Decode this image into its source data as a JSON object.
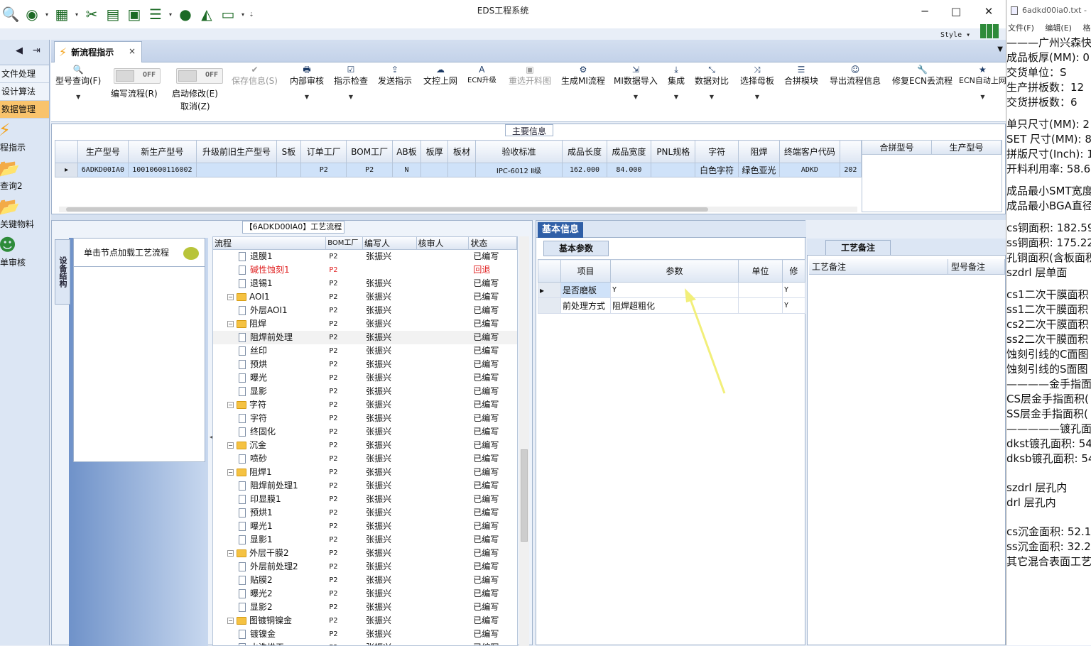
{
  "app": {
    "title": "EDS工程系统",
    "style_label": "Style"
  },
  "window_controls": {
    "minimize": "─",
    "maximize": "□",
    "close": "✕"
  },
  "quick_toolbar": [
    "search-icon",
    "globe-icon",
    "table-icon",
    "scissors-icon",
    "film-icon",
    "clipboard-icon",
    "list-icon",
    "user-icon",
    "chart-icon",
    "monitor-icon"
  ],
  "left_nav": {
    "items": [
      {
        "label": "文件处理"
      },
      {
        "label": "设计算法"
      },
      {
        "label": "数据管理"
      }
    ],
    "big": [
      {
        "label": "程指示",
        "icon": "bolt-icon"
      },
      {
        "label": "查询2",
        "icon": "folder-icon"
      },
      {
        "label": "关键物料",
        "icon": "folder-icon"
      },
      {
        "label": "单审核",
        "icon": "user-icon"
      }
    ]
  },
  "tab": {
    "label": "新流程指示",
    "close": "×"
  },
  "toolbar": {
    "model_query": "型号查询(F)",
    "toggle_off": "OFF",
    "write_flow": "编写流程(R)",
    "start_modify": "启动修改(E)",
    "cancel": "取消(Z)",
    "buttons": [
      {
        "label": "保存信息(S)",
        "icon": "✔"
      },
      {
        "label": "内部审核",
        "icon": "🖶"
      },
      {
        "label": "指示检查",
        "icon": "☑"
      },
      {
        "label": "发送指示",
        "icon": "⇪"
      },
      {
        "label": "文控上网",
        "icon": "☁"
      },
      {
        "label": "ECN升级",
        "icon": "A"
      },
      {
        "label": "重选开料图",
        "icon": "▣"
      },
      {
        "label": "生成MI流程",
        "icon": "⚙"
      },
      {
        "label": "MI数据导入",
        "icon": "⇲"
      },
      {
        "label": "集成",
        "icon": "⤓"
      },
      {
        "label": "数据对比",
        "icon": "⤡"
      },
      {
        "label": "选择母板",
        "icon": "⤨"
      },
      {
        "label": "合拼模块",
        "icon": "☰"
      },
      {
        "label": "导出流程信息",
        "icon": "☺"
      },
      {
        "label": "修复ECN丢流程",
        "icon": "🔧"
      },
      {
        "label": "ECN自动上网",
        "icon": "★"
      }
    ]
  },
  "main_info": {
    "title": "主要信息",
    "headers": [
      "生产型号",
      "新生产型号",
      "升级前旧生产型号",
      "S板",
      "订单工厂",
      "BOM工厂",
      "AB板",
      "板厚",
      "板材",
      "验收标准",
      "成品长度",
      "成品宽度",
      "PNL规格",
      "字符",
      "阻焊",
      "终端客户代码"
    ],
    "row": [
      "6ADKD00IA0",
      "10010600116002",
      "",
      "",
      "P2",
      "P2",
      "N",
      "",
      "",
      "IPC-6012 Ⅱ级",
      "162.000",
      "84.000",
      "",
      "白色字符",
      "绿色亚光",
      "ADKD",
      "202"
    ],
    "merge_headers": [
      "合拼型号",
      "生产型号"
    ]
  },
  "process": {
    "title": "【6ADKD00IA0】工艺流程",
    "vtab": "设备结构",
    "click_hint": "单击节点加载工艺流程",
    "headers": [
      "流程",
      "BOM工厂",
      "编写人",
      "核审人",
      "状态"
    ],
    "rows": [
      {
        "name": "退膜1",
        "lvl": 2,
        "factory": "P2",
        "writer": "张振兴",
        "status": "已编写"
      },
      {
        "name": "碱性蚀刻1",
        "lvl": 2,
        "factory": "P2",
        "writer": "",
        "status": "回退",
        "red": true
      },
      {
        "name": "退锡1",
        "lvl": 2,
        "factory": "P2",
        "writer": "张振兴",
        "status": "已编写"
      },
      {
        "name": "AOI1",
        "lvl": 1,
        "factory": "P2",
        "writer": "张振兴",
        "status": "已编写"
      },
      {
        "name": "外层AOI1",
        "lvl": 2,
        "factory": "P2",
        "writer": "张振兴",
        "status": "已编写"
      },
      {
        "name": "阻焊",
        "lvl": 1,
        "factory": "P2",
        "writer": "张振兴",
        "status": "已编写"
      },
      {
        "name": "阻焊前处理",
        "lvl": 2,
        "factory": "P2",
        "writer": "张振兴",
        "status": "已编写",
        "hl": true
      },
      {
        "name": "丝印",
        "lvl": 2,
        "factory": "P2",
        "writer": "张振兴",
        "status": "已编写"
      },
      {
        "name": "预烘",
        "lvl": 2,
        "factory": "P2",
        "writer": "张振兴",
        "status": "已编写"
      },
      {
        "name": "曝光",
        "lvl": 2,
        "factory": "P2",
        "writer": "张振兴",
        "status": "已编写"
      },
      {
        "name": "显影",
        "lvl": 2,
        "factory": "P2",
        "writer": "张振兴",
        "status": "已编写"
      },
      {
        "name": "字符",
        "lvl": 1,
        "factory": "P2",
        "writer": "张振兴",
        "status": "已编写"
      },
      {
        "name": "字符",
        "lvl": 2,
        "factory": "P2",
        "writer": "张振兴",
        "status": "已编写"
      },
      {
        "name": "终固化",
        "lvl": 2,
        "factory": "P2",
        "writer": "张振兴",
        "status": "已编写"
      },
      {
        "name": "沉金",
        "lvl": 1,
        "factory": "P2",
        "writer": "张振兴",
        "status": "已编写"
      },
      {
        "name": "喷砂",
        "lvl": 2,
        "factory": "P2",
        "writer": "张振兴",
        "status": "已编写"
      },
      {
        "name": "阻焊1",
        "lvl": 1,
        "factory": "P2",
        "writer": "张振兴",
        "status": "已编写"
      },
      {
        "name": "阻焊前处理1",
        "lvl": 2,
        "factory": "P2",
        "writer": "张振兴",
        "status": "已编写"
      },
      {
        "name": "印显膜1",
        "lvl": 2,
        "factory": "P2",
        "writer": "张振兴",
        "status": "已编写"
      },
      {
        "name": "预烘1",
        "lvl": 2,
        "factory": "P2",
        "writer": "张振兴",
        "status": "已编写"
      },
      {
        "name": "曝光1",
        "lvl": 2,
        "factory": "P2",
        "writer": "张振兴",
        "status": "已编写"
      },
      {
        "name": "显影1",
        "lvl": 2,
        "factory": "P2",
        "writer": "张振兴",
        "status": "已编写"
      },
      {
        "name": "外层干膜2",
        "lvl": 1,
        "factory": "P2",
        "writer": "张振兴",
        "status": "已编写"
      },
      {
        "name": "外层前处理2",
        "lvl": 2,
        "factory": "P2",
        "writer": "张振兴",
        "status": "已编写"
      },
      {
        "name": "贴膜2",
        "lvl": 2,
        "factory": "P2",
        "writer": "张振兴",
        "status": "已编写"
      },
      {
        "name": "曝光2",
        "lvl": 2,
        "factory": "P2",
        "writer": "张振兴",
        "status": "已编写"
      },
      {
        "name": "显影2",
        "lvl": 2,
        "factory": "P2",
        "writer": "张振兴",
        "status": "已编写"
      },
      {
        "name": "图镀铜镍金",
        "lvl": 1,
        "factory": "P2",
        "writer": "张振兴",
        "status": "已编写"
      },
      {
        "name": "镀镍金",
        "lvl": 2,
        "factory": "P2",
        "writer": "张振兴",
        "status": "已编写"
      },
      {
        "name": "水洗烘干",
        "lvl": 2,
        "factory": "P2",
        "writer": "张振兴",
        "status": "已编写"
      }
    ]
  },
  "basic_info": {
    "tab": "基本信息",
    "subtab": "基本参数",
    "headers": [
      "项目",
      "参数",
      "单位",
      "修"
    ],
    "rows": [
      {
        "item": "是否磨板",
        "param": "Y",
        "unit": "",
        "mod": "Y"
      },
      {
        "item": "前处理方式",
        "param": "阻焊超粗化",
        "unit": "",
        "mod": "Y"
      }
    ]
  },
  "notes": {
    "tab": "工艺备注",
    "col1": "工艺备注",
    "col2": "型号备注"
  },
  "notepad": {
    "title": "6adkd00ia0.txt -",
    "menu": [
      "文件(F)",
      "编辑(E)",
      "格"
    ],
    "lines": [
      "———广州兴森快",
      "成品板厚(MM): 0",
      "交货单位：S",
      "生产拼板数：12",
      "交货拼板数：6",
      "",
      "单只尺寸(MM): 2",
      "SET 尺寸(MM): 8",
      "拼版尺寸(Inch): 1",
      "开料利用率: 58.6",
      "",
      "成品最小SMT宽度",
      "成品最小BGA直径",
      "",
      "cs铜面积: 182.59",
      "ss铜面积: 175.22",
      "孔铜面积(含板面积",
      "szdrl      层单面",
      "",
      "cs1二次干膜面积",
      "ss1二次干膜面积",
      "cs2二次干膜面积",
      "ss2二次干膜面积",
      "蚀刻引线的C面图",
      "蚀刻引线的S面图",
      "————金手指面",
      "CS层金手指面积(",
      "SS层金手指面积(",
      "—————镀孔面",
      "dkst镀孔面积: 54",
      "dksb镀孔面积: 54",
      "",
      "",
      "szdrl      层孔内",
      "drl        层孔内",
      "",
      "",
      "cs沉金面积: 52.1",
      "ss沉金面积: 32.2",
      "其它混合表面工艺"
    ]
  }
}
